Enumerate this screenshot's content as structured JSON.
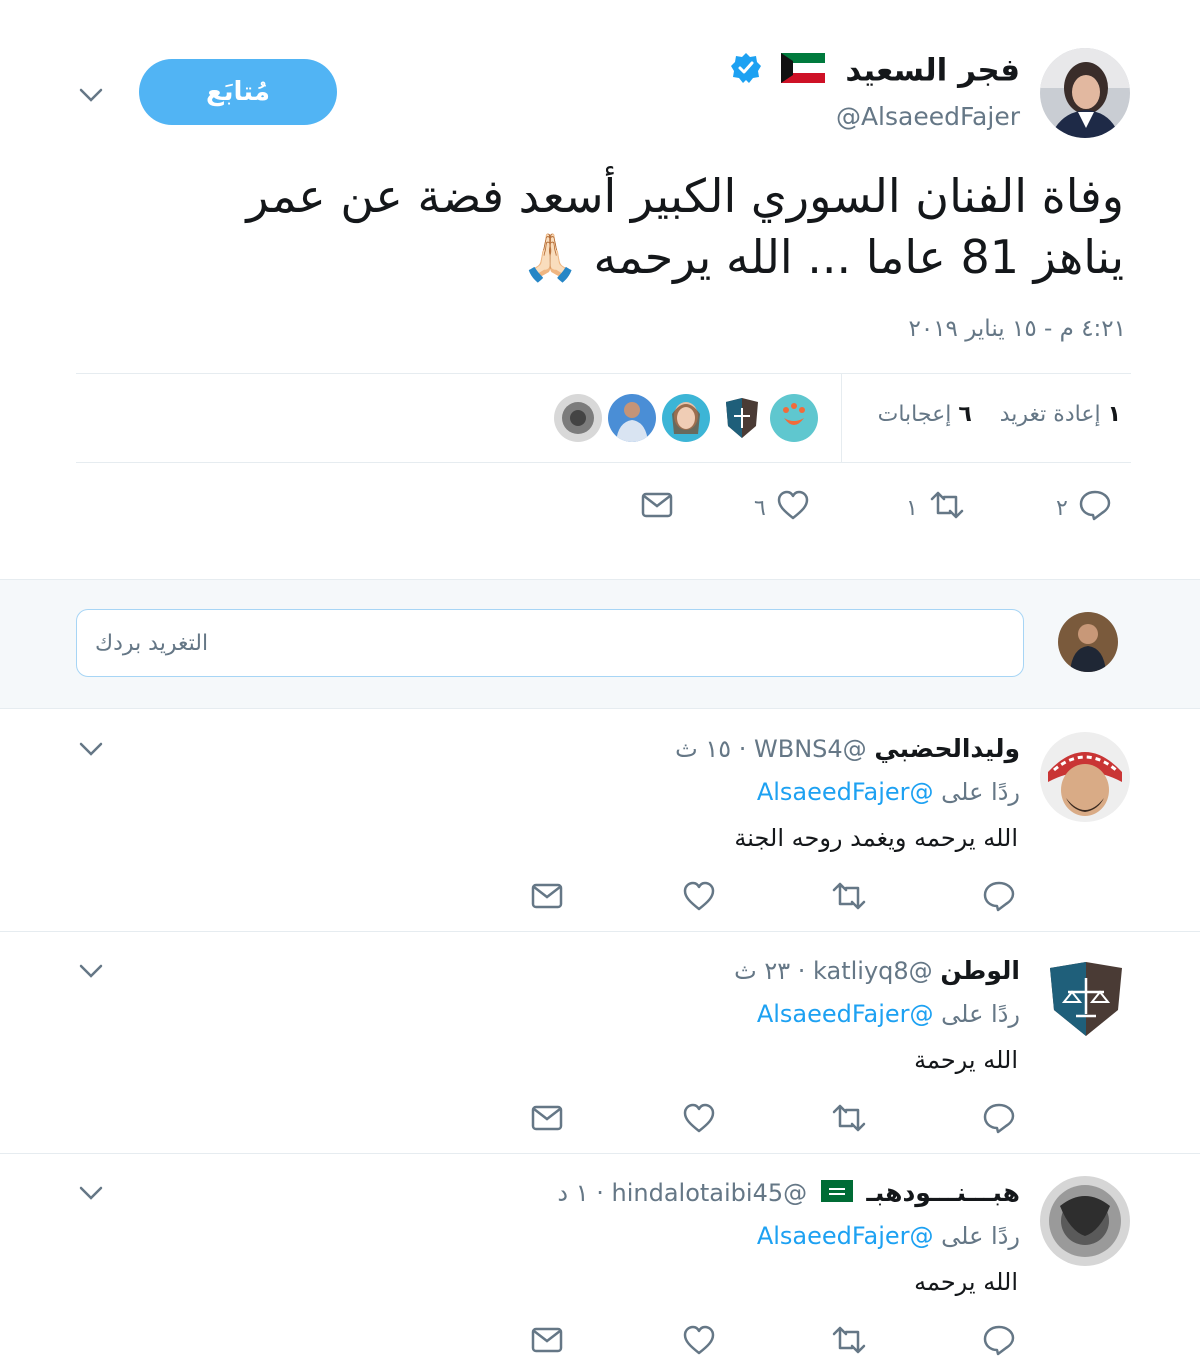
{
  "main_tweet": {
    "name": "فجر السعيد",
    "handle": "@AlsaeedFajer",
    "follow_label": "مُتابَع",
    "text_line1": "وفاة الفنان السوري الكبير أسعد فضة عن عمر",
    "text_line2": "يناهز 81 عاما ... الله يرحمه 🙏🏻",
    "timestamp": "٤:٢١ م - ١٥ يناير ٢٠١٩",
    "retweets_count": "١",
    "retweets_label": "إعادة تغريد",
    "likes_count": "٦",
    "likes_label": "إعجابات",
    "actions": {
      "reply_count": "٢",
      "retweet_count": "١",
      "like_count": "٦"
    },
    "flag": "kuwait",
    "verified": true
  },
  "composer": {
    "placeholder": "التغريد بردك"
  },
  "replies": [
    {
      "name": "وليدالحضبي",
      "handle": "@WBNS4",
      "time": "١٥ ث",
      "replying_label": "ردًا على",
      "replying_to": "@AlsaeedFajer",
      "text": "الله يرحمه ويغمد روحه الجنة"
    },
    {
      "name": "الوطن",
      "handle": "@katliyq8",
      "time": "٢٣ ث",
      "replying_label": "ردًا على",
      "replying_to": "@AlsaeedFajer",
      "text": "الله يرحمة"
    },
    {
      "name": "هبـــنـــودهبـ",
      "handle": "@hindalotaibi45",
      "time": "١ د",
      "replying_label": "ردًا على",
      "replying_to": "@AlsaeedFajer",
      "text": "الله يرحمه",
      "flag": "saudi"
    }
  ],
  "colors": {
    "accent": "#1da1f2",
    "follow_bg": "#51b4f4",
    "muted": "#657786",
    "divider": "#e6ecf0"
  }
}
